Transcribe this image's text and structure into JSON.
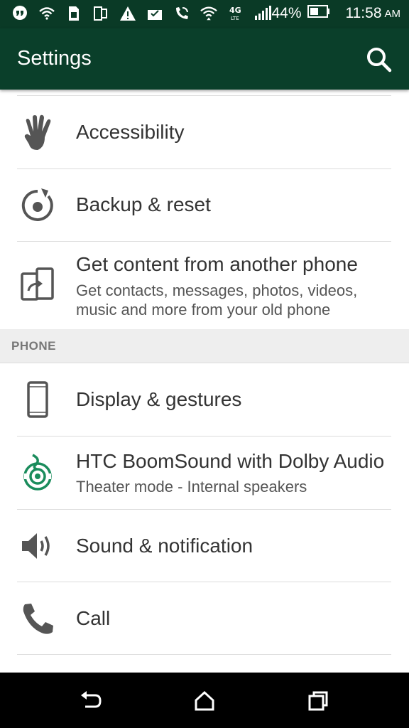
{
  "status_bar": {
    "battery_percent": "44%",
    "time": "11:58",
    "ampm": "AM",
    "icons": [
      "hangouts-icon",
      "wifi-icon",
      "sim-icon",
      "dual-screen-icon",
      "warning-icon",
      "inbox-check-icon",
      "wifi-calling-icon",
      "wifi-signal-icon",
      "4g-lte-icon",
      "cell-signal-icon",
      "battery-icon"
    ]
  },
  "app_bar": {
    "title": "Settings"
  },
  "items": [
    {
      "title": "Accessibility",
      "icon": "accessibility-hand-icon"
    },
    {
      "title": "Backup & reset",
      "icon": "backup-reset-icon"
    },
    {
      "title": "Get content from another phone",
      "subtitle": "Get contacts, messages, photos, videos, music and more from your old phone",
      "icon": "transfer-phone-icon"
    }
  ],
  "section_phone": "PHONE",
  "phone_items": [
    {
      "title": "Display & gestures",
      "icon": "phone-display-icon"
    },
    {
      "title": "HTC BoomSound with Dolby Audio",
      "subtitle": "Theater mode - Internal speakers",
      "icon": "boomsound-icon"
    },
    {
      "title": "Sound & notification",
      "icon": "speaker-icon"
    },
    {
      "title": "Call",
      "icon": "phone-call-icon"
    }
  ],
  "colors": {
    "app_bar": "#0a3f2a",
    "status_bar": "#0a3a26",
    "boomsound_accent": "#1a8c5c"
  }
}
